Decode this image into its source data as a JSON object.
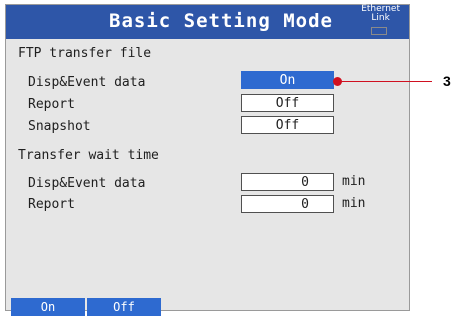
{
  "header": {
    "title": "Basic Setting Mode",
    "status_line1": "Ethernet",
    "status_line2": "Link"
  },
  "ftp": {
    "section_label": "FTP transfer file",
    "rows": [
      {
        "label": "Disp&Event data",
        "value": "On"
      },
      {
        "label": "Report",
        "value": "Off"
      },
      {
        "label": "Snapshot",
        "value": "Off"
      }
    ]
  },
  "wait": {
    "section_label": "Transfer wait time",
    "rows": [
      {
        "label": "Disp&Event data",
        "value": "0",
        "unit": "min"
      },
      {
        "label": "Report",
        "value": "0",
        "unit": "min"
      }
    ]
  },
  "softkeys": [
    {
      "label": "On"
    },
    {
      "label": "Off"
    }
  ],
  "callout": {
    "number": "3"
  },
  "colors": {
    "title_bar": "#2e56a8",
    "selected": "#2e6ad0",
    "callout": "#d01020"
  }
}
